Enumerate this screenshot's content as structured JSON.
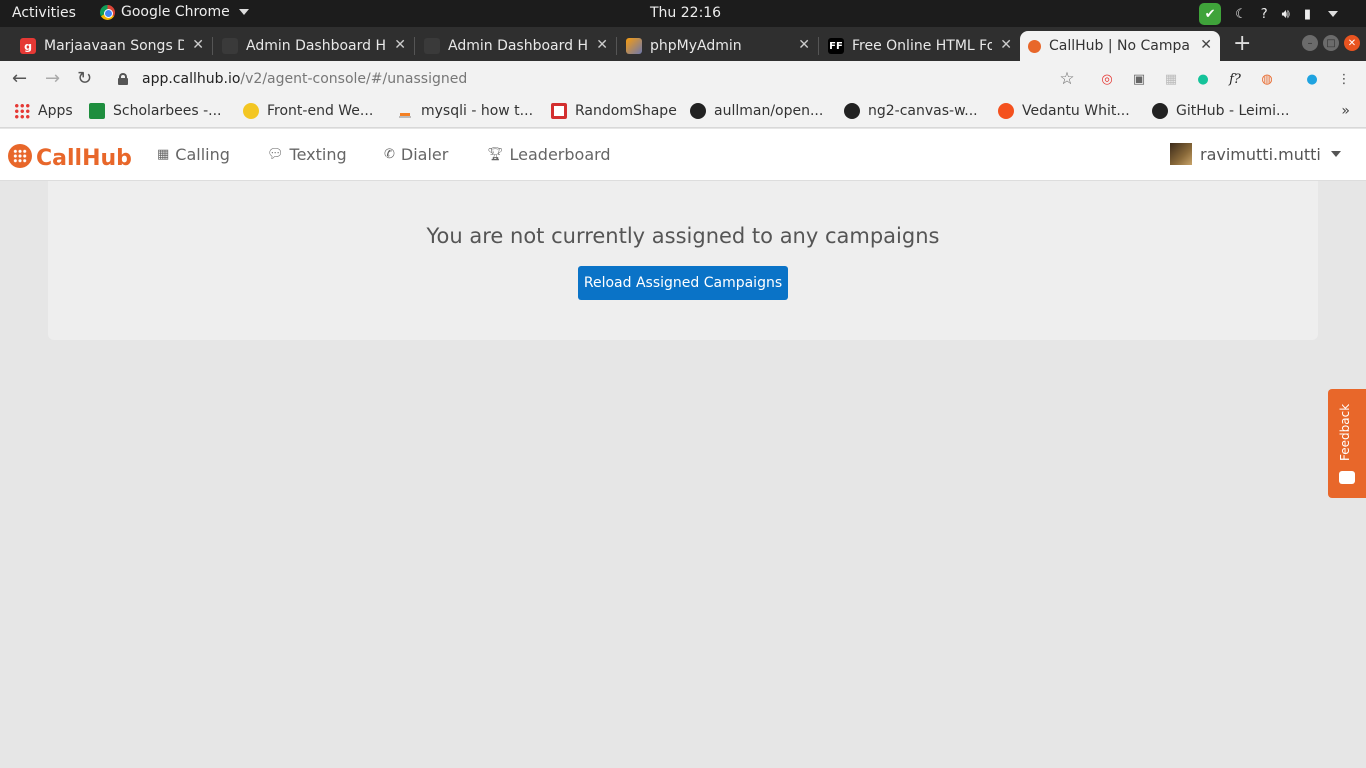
{
  "os": {
    "activities": "Activities",
    "app_name": "Google Chrome",
    "clock": "Thu 22:16",
    "tray_help": "?"
  },
  "tabs": [
    {
      "title": "Marjaavaan Songs D",
      "favicon": "g"
    },
    {
      "title": "Admin Dashboard H",
      "favicon": ""
    },
    {
      "title": "Admin Dashboard H",
      "favicon": ""
    },
    {
      "title": "phpMyAdmin",
      "favicon": ""
    },
    {
      "title": "Free Online HTML Fo",
      "favicon": "FF"
    },
    {
      "title": "CallHub | No Campai",
      "favicon": ""
    }
  ],
  "address_bar": {
    "host": "app.callhub.io",
    "path": "/v2/agent-console/#/unassigned"
  },
  "bookmarks": [
    {
      "label": "Apps",
      "icon": "apps-grid-icon"
    },
    {
      "label": "Scholarbees -...",
      "icon": "scholarbees-icon"
    },
    {
      "label": "Front-end We...",
      "icon": "frontend-icon"
    },
    {
      "label": "mysqli - how t...",
      "icon": "stackoverflow-icon"
    },
    {
      "label": "RandomShape",
      "icon": "randomshape-icon"
    },
    {
      "label": "aullman/open...",
      "icon": "github-icon"
    },
    {
      "label": "ng2-canvas-w...",
      "icon": "github-icon"
    },
    {
      "label": "Vedantu Whit...",
      "icon": "vedantu-icon"
    },
    {
      "label": "GitHub - Leimi...",
      "icon": "github-icon"
    }
  ],
  "app": {
    "brand": "CallHub",
    "nav": [
      {
        "label": "Calling",
        "icon": "table-icon"
      },
      {
        "label": "Texting",
        "icon": "comments-icon"
      },
      {
        "label": "Dialer",
        "icon": "phone-icon"
      },
      {
        "label": "Leaderboard",
        "icon": "trophy-icon"
      }
    ],
    "user": "ravimutti.mutti",
    "brand_color": "#e8672a",
    "button_color": "#0a73c7"
  },
  "main": {
    "message": "You are not currently assigned to any campaigns",
    "reload_button": "Reload Assigned Campaigns"
  },
  "feedback": {
    "label": "Feedback"
  }
}
